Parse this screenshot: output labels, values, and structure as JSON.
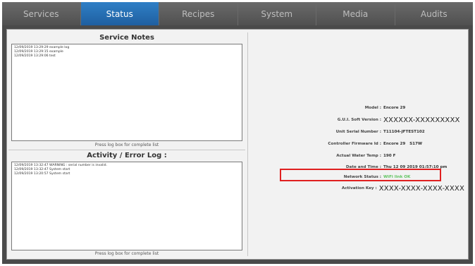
{
  "tabs": [
    {
      "label": "Services",
      "active": false
    },
    {
      "label": "Status",
      "active": true
    },
    {
      "label": "Recipes",
      "active": false
    },
    {
      "label": "System",
      "active": false
    },
    {
      "label": "Media",
      "active": false
    },
    {
      "label": "Audits",
      "active": false
    }
  ],
  "service_notes": {
    "title": "Service Notes",
    "lines": [
      "12/09/2019 13:29:29 example log",
      "12/09/2019 13:29:15 example",
      "12/09/2019 13:29:06 test"
    ],
    "hint": "Press log box for complete list"
  },
  "activity_log": {
    "title": "Activity / Error Log :",
    "lines": [
      "12/09/2019 13:32:47 WARNING : serial number is invalid.",
      "12/09/2019 13:32:47 System start",
      "12/09/2019 13:20:57 System start"
    ],
    "hint": "Press log box for complete list"
  },
  "status_info": {
    "model": {
      "label": "Model :",
      "value": "Encore 29"
    },
    "gui_version": {
      "label": "G.U.I. Soft Version :",
      "value": "XXXXXX-XXXXXXXXX"
    },
    "serial": {
      "label": "Unit Serial Number :",
      "value": "T11104-JFTEST102"
    },
    "firmware": {
      "label": "Controller Firmware Id :",
      "value": "Encore 29   S17W"
    },
    "water_temp": {
      "label": "Actual Water Temp :",
      "value": "190 F"
    },
    "datetime": {
      "label": "Date and Time :",
      "value": "Thu 12 09 2019 01:57:10 pm"
    },
    "network": {
      "label": "Network Status :",
      "value": "WiFi link OK"
    },
    "activation": {
      "label": "Activation Key :",
      "value": "XXXX-XXXX-XXXX-XXXX"
    }
  },
  "colors": {
    "active_tab": "#2f7fc6",
    "network_ok": "#5fc35f",
    "highlight": "#e02020"
  }
}
